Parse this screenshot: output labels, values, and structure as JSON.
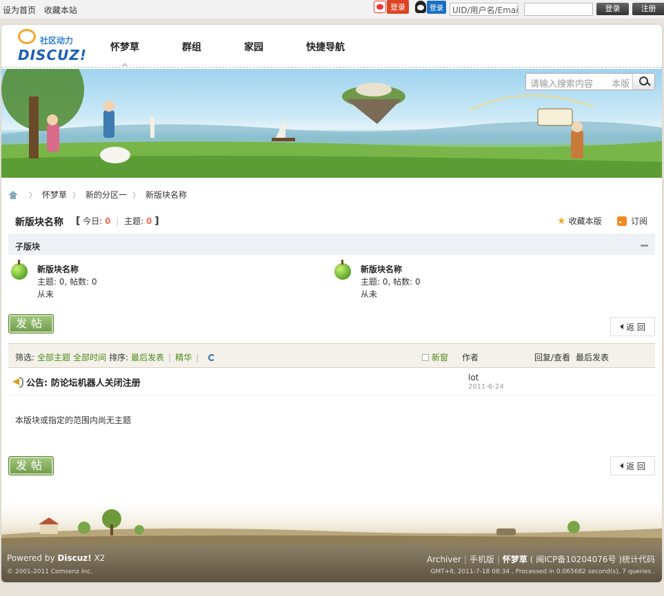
{
  "topbar": {
    "set_home": "设为首页",
    "bookmark": "收藏本站",
    "weibo_login": "登录",
    "qq_login": "登录",
    "uid_placeholder": "UID/用户名/Emai",
    "login_btn": "登录",
    "register_btn": "注册"
  },
  "logo": {
    "tagline": "社区动力",
    "brand": "DISCUZ!"
  },
  "nav": [
    "怀梦草",
    "群组",
    "家园",
    "快捷导航"
  ],
  "search": {
    "placeholder": "请输入搜索内容",
    "scope": "本版"
  },
  "breadcrumb": [
    "怀梦草",
    "新的分区一",
    "新版块名称"
  ],
  "forum": {
    "title": "新版块名称",
    "today_label": "今日:",
    "today_count": "0",
    "threads_label": "主题:",
    "threads_count": "0",
    "favorite": "收藏本版",
    "subscribe": "订阅"
  },
  "subforums": {
    "heading": "子版块",
    "items": [
      {
        "name": "新版块名称",
        "stats": "主题: 0, 帖数: 0",
        "last": "从未"
      },
      {
        "name": "新版块名称",
        "stats": "主题: 0, 帖数: 0",
        "last": "从未"
      }
    ]
  },
  "buttons": {
    "post": "发帖",
    "back": "返 回"
  },
  "threadlist": {
    "filter_label": "筛选:",
    "all_threads": "全部主题",
    "all_time": "全部时间",
    "sort_label": "排序:",
    "last_post": "最后发表",
    "digest": "精华",
    "new_window": "新窗",
    "col_author": "作者",
    "col_reply": "回复/查看",
    "col_last": "最后发表",
    "notice_title": "公告: 防论坛机器人关闭注册",
    "notice_author": "lot",
    "notice_date": "2011-6-24",
    "empty": "本版块或指定的范围内尚无主题"
  },
  "footer": {
    "powered_prefix": "Powered by",
    "powered_brand": "Discuz!",
    "powered_version": "X2",
    "copyright": "© 2001-2011 Comsenz Inc.",
    "archiver": "Archiver",
    "mobile": "手机版",
    "site": "怀梦草",
    "icp": "( 闽ICP备10204076号 )统计代码",
    "gmt": "GMT+8, 2011-7-18 08:34 , Processed in 0.065682 second(s), 7 queries ."
  },
  "colors": {
    "accent_green": "#4a8a1a",
    "count_red": "#f26c4f",
    "nav_blue": "#1d5fb4"
  }
}
